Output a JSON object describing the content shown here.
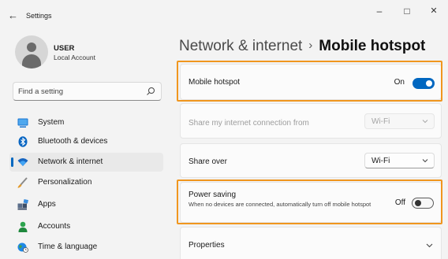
{
  "window": {
    "title": "Settings",
    "back_icon": "←",
    "minimize_icon": "–",
    "maximize_icon": "□",
    "close_icon": "✕"
  },
  "profile": {
    "name": "USER",
    "account_type": "Local Account"
  },
  "search": {
    "placeholder": "Find a setting"
  },
  "sidebar": {
    "items": [
      {
        "label": "System",
        "icon": "monitor-icon",
        "selected": false
      },
      {
        "label": "Bluetooth & devices",
        "icon": "bluetooth-icon",
        "selected": false
      },
      {
        "label": "Network & internet",
        "icon": "wifi-icon",
        "selected": true
      },
      {
        "label": "Personalization",
        "icon": "brush-icon",
        "selected": false
      },
      {
        "label": "Apps",
        "icon": "apps-icon",
        "selected": false
      },
      {
        "label": "Accounts",
        "icon": "person-icon",
        "selected": false
      },
      {
        "label": "Time & language",
        "icon": "globe-clock-icon",
        "selected": false
      }
    ]
  },
  "breadcrumb": {
    "parent": "Network & internet",
    "separator": "›",
    "current": "Mobile hotspot"
  },
  "settings": {
    "mobile_hotspot": {
      "label": "Mobile hotspot",
      "state": "On",
      "enabled": true
    },
    "share_from": {
      "label": "Share my internet connection from",
      "value": "Wi-Fi",
      "disabled": true
    },
    "share_over": {
      "label": "Share over",
      "value": "Wi-Fi"
    },
    "power_saving": {
      "label": "Power saving",
      "description": "When no devices are connected, automatically turn off mobile hotspot",
      "state": "Off",
      "enabled": false
    },
    "properties": {
      "label": "Properties"
    }
  },
  "colors": {
    "accent": "#0067c0",
    "highlight": "#f0961e",
    "background": "#f3f3f3",
    "card": "#fbfbfb"
  }
}
